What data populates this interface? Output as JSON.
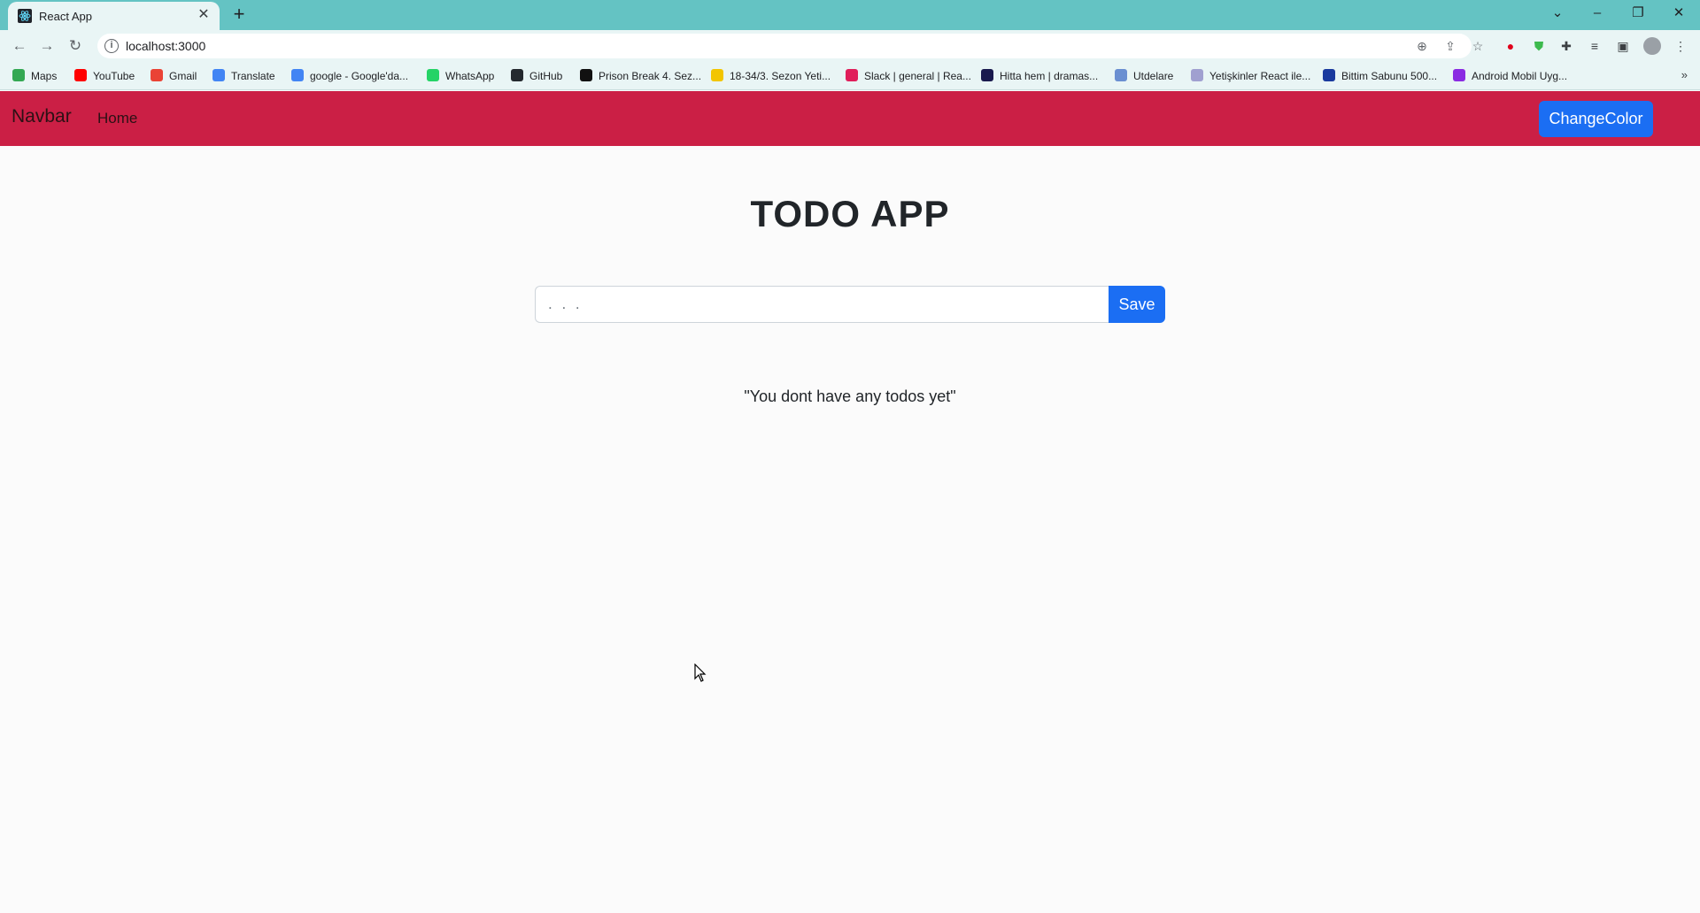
{
  "browser": {
    "tab_title": "React App",
    "url": "localhost:3000",
    "bookmarks": [
      {
        "label": "Maps",
        "color": "#34a853"
      },
      {
        "label": "YouTube",
        "color": "#ff0000"
      },
      {
        "label": "Gmail",
        "color": "#ea4335"
      },
      {
        "label": "Translate",
        "color": "#4285f4"
      },
      {
        "label": "google - Google'da...",
        "color": "#4285f4"
      },
      {
        "label": "WhatsApp",
        "color": "#25d366"
      },
      {
        "label": "GitHub",
        "color": "#24292e"
      },
      {
        "label": "Prison Break 4. Sez...",
        "color": "#111111"
      },
      {
        "label": "18-34/3. Sezon Yeti...",
        "color": "#f2c500"
      },
      {
        "label": "Slack | general | Rea...",
        "color": "#e01e5a"
      },
      {
        "label": "Hitta hem | dramas...",
        "color": "#1a1a4e"
      },
      {
        "label": "Utdelare",
        "color": "#6a8fd1"
      },
      {
        "label": "Yetişkinler React ile...",
        "color": "#a0a0d0"
      },
      {
        "label": "Bittim Sabunu 500...",
        "color": "#1a3a9e"
      },
      {
        "label": "Android Mobil Uyg...",
        "color": "#8a2be2"
      }
    ]
  },
  "navbar": {
    "brand": "Navbar",
    "home_link": "Home",
    "change_color_label": "ChangeColor"
  },
  "main": {
    "title": "TODO APP",
    "input_placeholder": ". . .",
    "save_label": "Save",
    "empty_message": "\"You dont have any todos yet\""
  },
  "colors": {
    "navbar_bg": "#cb1f45",
    "primary_button": "#1b6ef3",
    "page_bg": "#fbfbfb"
  }
}
